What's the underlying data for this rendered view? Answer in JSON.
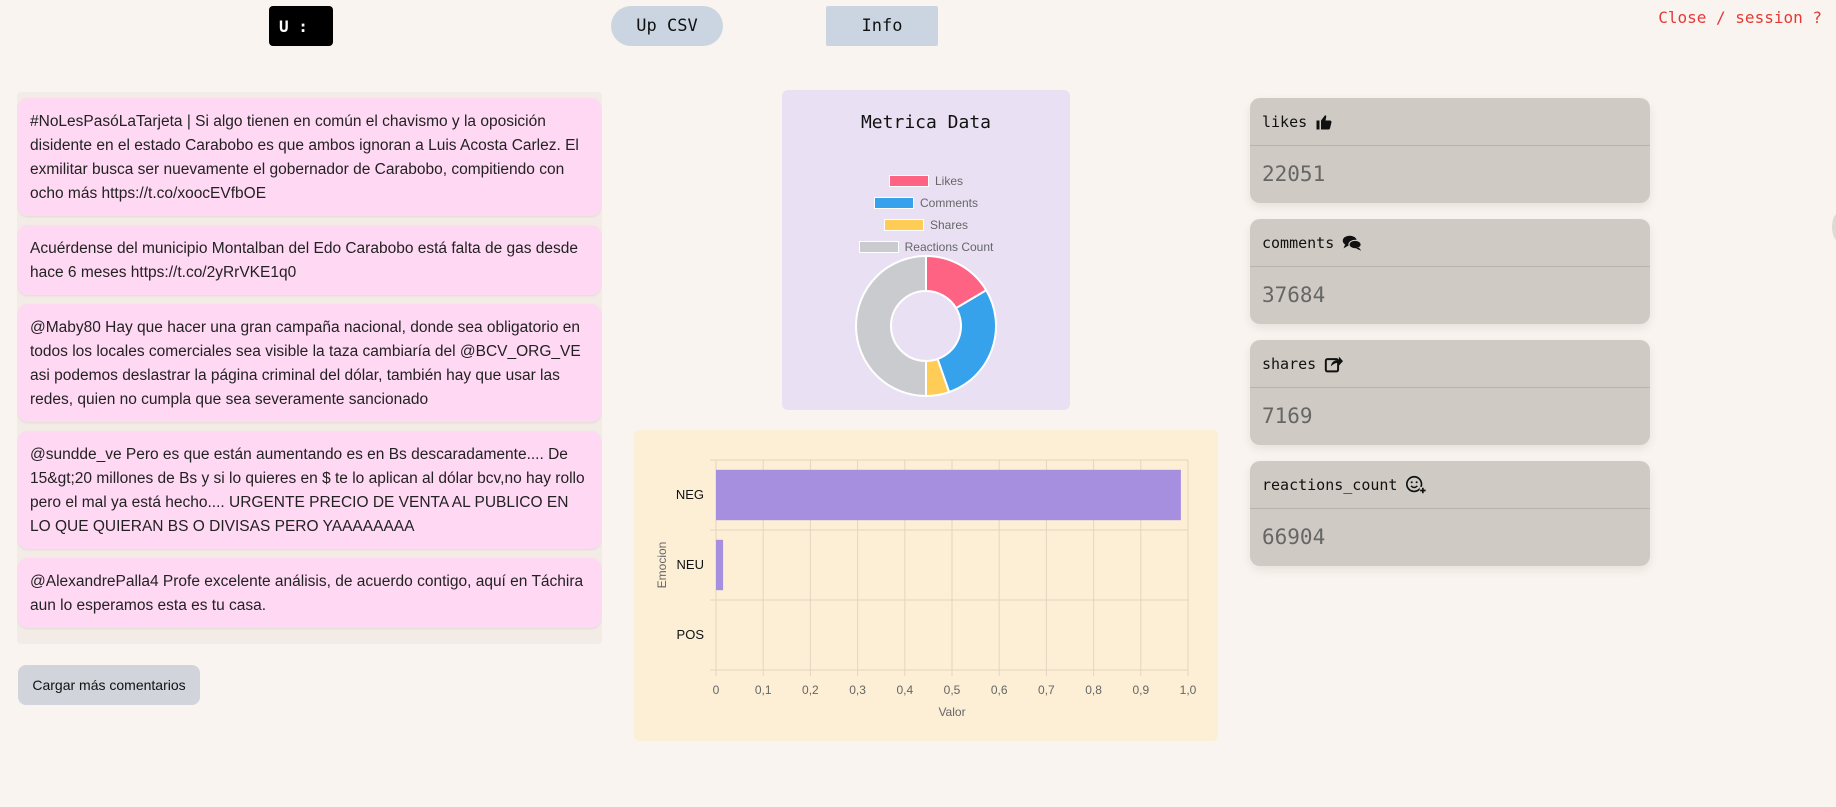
{
  "header": {
    "user_label": "U :",
    "upload_label": "Up CSV",
    "info_label": "Info",
    "close_label": "Close / session ?"
  },
  "comments": [
    "#NoLesPasóLaTarjeta | Si algo tienen en común el chavismo y la oposición disidente en el estado Carabobo es que ambos ignoran a Luis Acosta Carlez. El exmilitar busca ser nuevamente el gobernador de Carabobo, compitiendo con ocho más https://t.co/xoocEVfbOE",
    "Acuérdense del municipio Montalban del Edo Carabobo está falta de gas desde hace 6 meses https://t.co/2yRrVKE1q0",
    "@Maby80 Hay que hacer una gran campaña nacional, donde sea obligatorio en todos los locales comerciales sea visible la taza cambiaría del @BCV_ORG_VE asi podemos deslastrar la página criminal del dólar, también hay que usar las redes, quien no cumpla que sea severamente sancionado",
    "@sundde_ve Pero es que están aumentando es en Bs descaradamente.... De 15&gt;20 millones de Bs y si lo quieres en $ te lo aplican al dólar bcv,no hay rollo pero el mal ya está hecho.... URGENTE PRECIO DE VENTA AL PUBLICO EN LO QUE QUIERAN BS O DIVISAS PERO YAAAAAAAA",
    "@AlexandrePalla4 Profe excelente análisis, de acuerdo contigo, aquí en Táchira aun lo esperamos esta es tu casa."
  ],
  "load_more_label": "Cargar más comentarios",
  "metrics": [
    {
      "label": "likes",
      "value": "22051",
      "icon": "thumbs-up-icon"
    },
    {
      "label": "comments",
      "value": "37684",
      "icon": "comments-icon"
    },
    {
      "label": "shares",
      "value": "7169",
      "icon": "share-icon"
    },
    {
      "label": "reactions_count",
      "value": "66904",
      "icon": "smile-plus-icon"
    }
  ],
  "chart_data": [
    {
      "type": "pie",
      "variant": "doughnut",
      "title": "Metrica Data",
      "legend_position": "top",
      "categories": [
        "Likes",
        "Comments",
        "Shares",
        "Reactions Count"
      ],
      "values": [
        22051,
        37684,
        7169,
        66904
      ],
      "colors": [
        "#ff6384",
        "#36a2eb",
        "#ffcd56",
        "#c9cbcf"
      ]
    },
    {
      "type": "bar",
      "orientation": "horizontal",
      "categories": [
        "NEG",
        "NEU",
        "POS"
      ],
      "values": [
        0.985,
        0.015,
        0
      ],
      "xlabel": "Valor",
      "ylabel": "Emocion",
      "xlim": [
        0,
        1.0
      ],
      "x_ticks": [
        "0",
        "0,1",
        "0,2",
        "0,3",
        "0,4",
        "0,5",
        "0,6",
        "0,7",
        "0,8",
        "0,9",
        "1,0"
      ],
      "grid": true,
      "bar_color": "#a78fe0"
    }
  ]
}
